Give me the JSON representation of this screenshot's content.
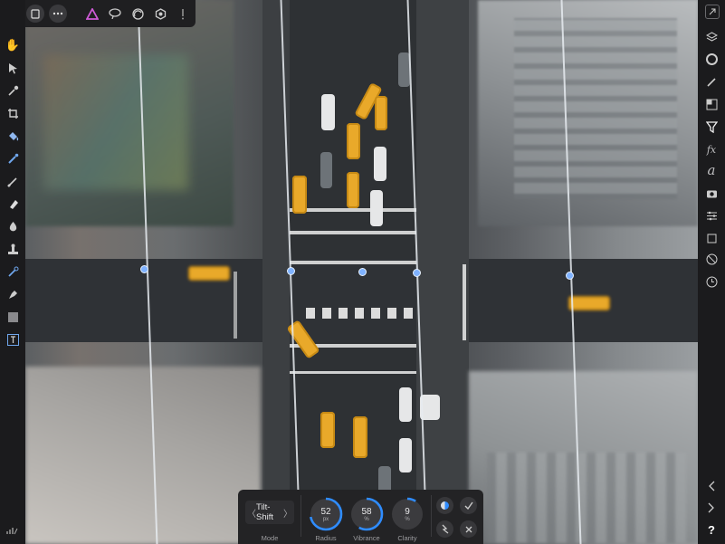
{
  "top_bar": {
    "back_icon": "back-arrow-icon",
    "document_icon": "document-icon",
    "more_icon": "more-ellipsis-icon"
  },
  "filter": {
    "mode": {
      "value": "Tilt-Shift",
      "caption": "Mode"
    },
    "radius": {
      "value": "52",
      "unit": "px",
      "caption": "Radius",
      "fraction": 0.72
    },
    "vibrance": {
      "value": "58",
      "unit": "%",
      "caption": "Vibrance",
      "fraction": 0.58
    },
    "clarity": {
      "value": "9",
      "unit": "%",
      "caption": "Clarity",
      "fraction": 0.09
    }
  },
  "colors": {
    "accent": "#2f8cff",
    "panel": "#232325",
    "taxi": "#e9a92a"
  },
  "help_label": "?"
}
